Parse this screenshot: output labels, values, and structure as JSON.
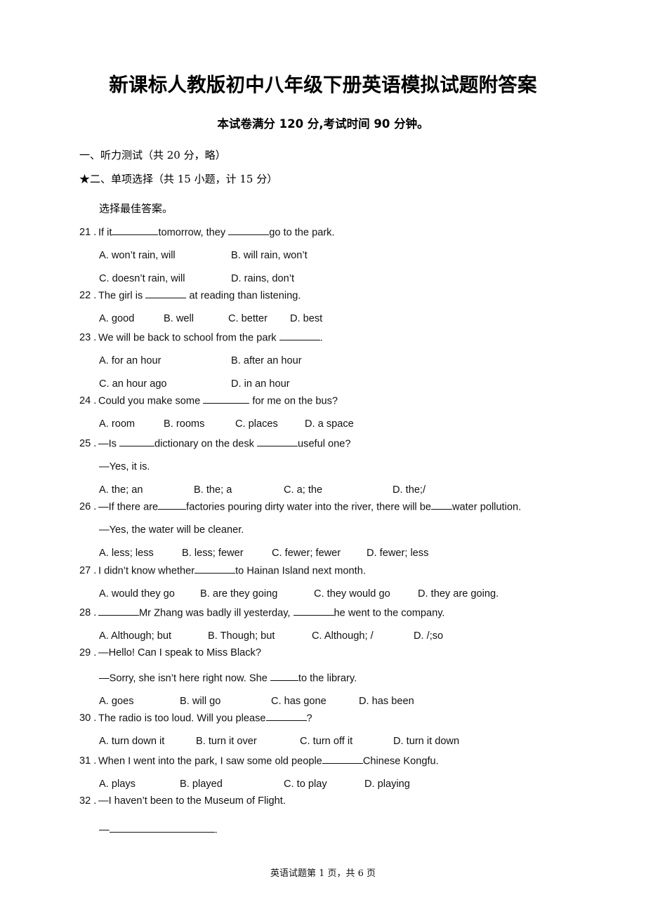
{
  "document": {
    "title": "新课标人教版初中八年级下册英语模拟试题附答案",
    "subtitle": "本试卷满分 120 分,考试时间 90 分钟。",
    "footer": "英语试题第 1 页，共 6 页"
  },
  "sections": {
    "listening": "一、听力测试（共 20 分，略）",
    "multiple_choice": "★二、单项选择（共 15 小题，计 15 分）",
    "instruction": "选择最佳答案。"
  },
  "questions": [
    {
      "number": "21 .",
      "stem_a": "If it",
      "stem_b": "tomorrow, they ",
      "stem_c": "go to the park.",
      "options": [
        "A. won’t rain, will",
        "B. will rain, won’t",
        "C. doesn’t rain, will",
        "D. rains, don’t"
      ]
    },
    {
      "number": "22 .",
      "stem_a": "The girl is ",
      "stem_b": " at reading than listening.",
      "options": [
        "A. good",
        "B. well",
        "C. better",
        "D. best"
      ]
    },
    {
      "number": "23 .",
      "stem_a": "We will be back to school from the park ",
      "stem_b": ".",
      "options": [
        "A. for an hour",
        "B. after an hour",
        "C. an hour ago",
        "D. in an hour"
      ]
    },
    {
      "number": "24 .",
      "stem_a": "Could you make some ",
      "stem_b": " for me on the bus?",
      "options": [
        "A. room",
        "B. rooms",
        "C. places",
        "D. a space"
      ]
    },
    {
      "number": "25 .",
      "stem_a": "—Is ",
      "stem_b": "dictionary on the desk ",
      "stem_c": "useful one?",
      "reply": "—Yes, it is.",
      "options": [
        "A. the; an",
        "B. the; a",
        "C. a; the",
        "D. the;/"
      ]
    },
    {
      "number": "26 .",
      "stem_a": "—If there are",
      "stem_b": "factories pouring dirty water into the river, there will be",
      "stem_c": "water pollution.",
      "reply": "—Yes, the water will be cleaner.",
      "options": [
        "A. less; less",
        "B. less; fewer",
        "C. fewer; fewer",
        "D. fewer; less"
      ]
    },
    {
      "number": "27 .",
      "stem_a": "I didn’t know whether",
      "stem_b": "to Hainan Island next month.",
      "options": [
        "A. would they go",
        "B. are they going",
        "C. they would go",
        "D. they are going."
      ]
    },
    {
      "number": "28 .",
      "stem_a": "",
      "stem_b": "Mr Zhang was badly ill yesterday, ",
      "stem_c": "he went to the company.",
      "options": [
        "A. Although; but",
        "B. Though; but",
        "C. Although; /",
        "D. /;so"
      ]
    },
    {
      "number": "29 .",
      "stem_a": "—Hello! Can I speak to Miss Black?",
      "reply_a": "—Sorry, she isn’t here right now. She ",
      "reply_b": "to the library.",
      "options": [
        "A. goes",
        "B. will go",
        "C. has gone",
        "D. has been"
      ]
    },
    {
      "number": "30 .",
      "stem_a": "The radio is too loud. Will you please",
      "stem_b": "?",
      "options": [
        "A. turn   down   it",
        "B. turn it over",
        "C. turn off it",
        "D. turn it down"
      ]
    },
    {
      "number": "31 .",
      "stem_a": "When I went into the park, I saw some old people",
      "stem_b": "Chinese Kongfu.",
      "options": [
        "A. plays",
        "B. played",
        "C. to play",
        "D. playing"
      ]
    },
    {
      "number": "32 .",
      "stem_a": "—I haven’t been to the Museum of Flight.",
      "reply_a": "—",
      "reply_b": "."
    }
  ]
}
